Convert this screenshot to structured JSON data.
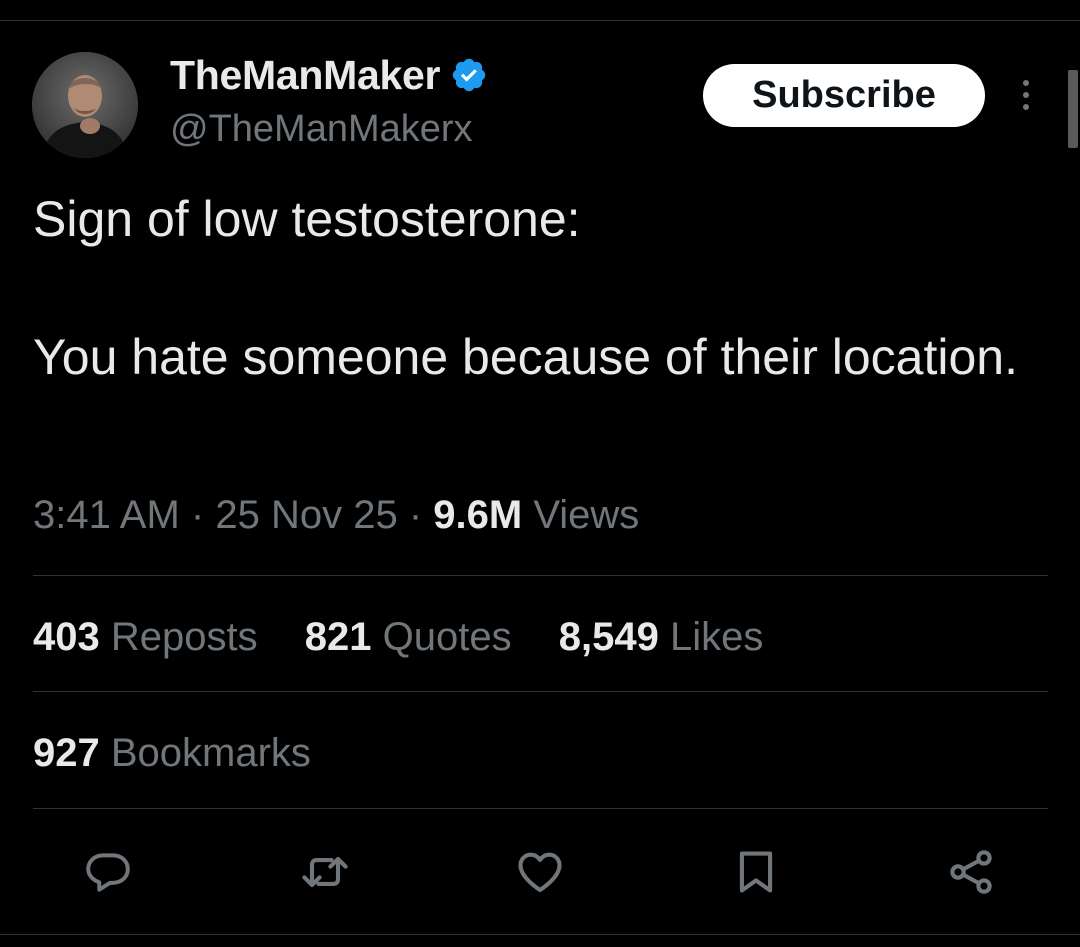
{
  "tweet": {
    "author": {
      "display_name": "TheManMaker",
      "handle": "@TheManMakerx",
      "verified": true,
      "verified_color": "#1d9bf0"
    },
    "subscribe_label": "Subscribe",
    "text": "Sign of low testosterone:\n\nYou hate someone because of their location.",
    "time": "3:41 AM",
    "date": "25 Nov 25",
    "separator": "·",
    "views_count": "9.6M",
    "views_label": "Views",
    "stats": {
      "reposts_count": "403",
      "reposts_label": "Reposts",
      "quotes_count": "821",
      "quotes_label": "Quotes",
      "likes_count": "8,549",
      "likes_label": "Likes",
      "bookmarks_count": "927",
      "bookmarks_label": "Bookmarks"
    },
    "actions": [
      {
        "icon": "reply-icon"
      },
      {
        "icon": "repost-icon"
      },
      {
        "icon": "like-icon"
      },
      {
        "icon": "bookmark-icon"
      },
      {
        "icon": "share-icon"
      }
    ]
  },
  "theme": {
    "background": "#000000",
    "text_primary": "#e7e9ea",
    "text_secondary": "#71767b",
    "divider": "#2f3336"
  }
}
